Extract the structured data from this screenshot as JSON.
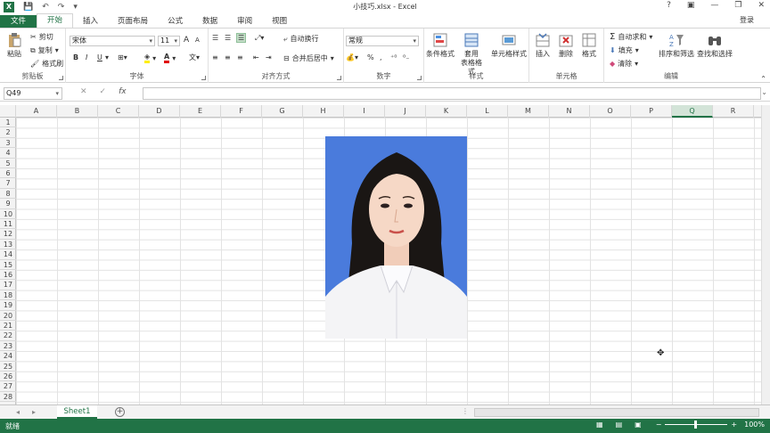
{
  "window": {
    "title": "小技巧.xlsx - Excel",
    "help": "?",
    "login": "登录"
  },
  "tabs": [
    {
      "label": "文件"
    },
    {
      "label": "开始"
    },
    {
      "label": "插入"
    },
    {
      "label": "页面布局"
    },
    {
      "label": "公式"
    },
    {
      "label": "数据"
    },
    {
      "label": "审阅"
    },
    {
      "label": "视图"
    }
  ],
  "ribbon": {
    "clipboard": {
      "label": "剪贴板",
      "paste": "粘贴",
      "cut": "剪切",
      "copy": "复制",
      "format_painter": "格式刷"
    },
    "font": {
      "label": "字体",
      "name": "宋体",
      "size": "11",
      "bold": "B",
      "italic": "I",
      "underline": "U",
      "grow": "A",
      "shrink": "A"
    },
    "alignment": {
      "label": "对齐方式",
      "wrap": "自动换行",
      "merge": "合并后居中"
    },
    "number": {
      "label": "数字",
      "format": "常规",
      "percent": "%",
      "comma": ","
    },
    "styles": {
      "label": "样式",
      "conditional": "条件格式",
      "table1": "套用",
      "table2": "表格格式",
      "cell_styles": "单元格样式"
    },
    "cells": {
      "label": "单元格",
      "insert": "插入",
      "delete": "删除",
      "format": "格式"
    },
    "editing": {
      "label": "编辑",
      "autosum": "自动求和",
      "fill": "填充",
      "clear": "清除",
      "sort": "排序和筛选",
      "find": "查找和选择"
    }
  },
  "formula": {
    "namebox": "Q49",
    "fx": "fx",
    "value": ""
  },
  "columns": [
    "A",
    "B",
    "C",
    "D",
    "E",
    "F",
    "G",
    "H",
    "I",
    "J",
    "K",
    "L",
    "M",
    "N",
    "O",
    "P",
    "Q",
    "R"
  ],
  "rows": [
    "1",
    "2",
    "3",
    "4",
    "5",
    "6",
    "7",
    "8",
    "9",
    "10",
    "11",
    "12",
    "13",
    "14",
    "15",
    "16",
    "17",
    "18",
    "19",
    "20",
    "21",
    "22",
    "23",
    "24",
    "25",
    "26",
    "27",
    "28"
  ],
  "sheets": [
    {
      "name": "Sheet1"
    }
  ],
  "status": {
    "ready": "就绪",
    "zoom": "100%",
    "minus": "−",
    "plus": "+"
  },
  "colors": {
    "accent": "#217346",
    "photo_bg": "#4a7bdc"
  }
}
